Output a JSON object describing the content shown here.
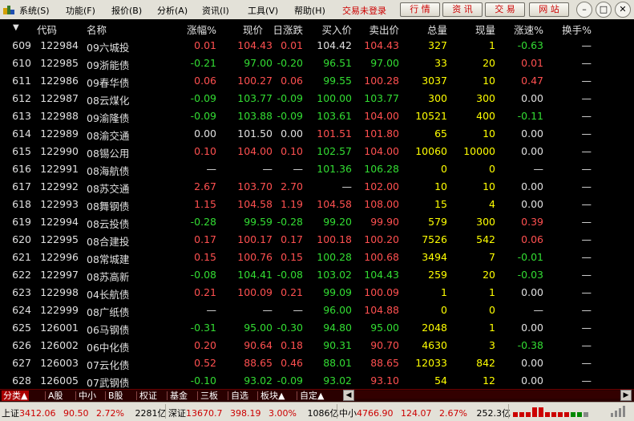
{
  "menubar": {
    "items": [
      "系统(S)",
      "功能(F)",
      "报价(B)",
      "分析(A)",
      "资讯(I)",
      "工具(V)",
      "帮助(H)"
    ],
    "trade_status": "交易未登录",
    "tool_buttons": [
      "行 情",
      "资 讯",
      "交 易",
      "网 站"
    ],
    "window_buttons": {
      "minimize": "–",
      "restore": "□",
      "close": "✕"
    }
  },
  "table": {
    "sort_indicator": "▼",
    "headers": {
      "code": "代码",
      "name": "名称",
      "change_pct": "涨幅%",
      "price": "现价",
      "day_change": "日涨跌",
      "bid": "买入价",
      "ask": "卖出价",
      "volume": "总量",
      "cur_vol": "现量",
      "speed": "涨速%",
      "turnover": "换手%"
    },
    "rows": [
      {
        "seq": "609",
        "code": "122984",
        "name": "09六城投",
        "chg": "0.01",
        "price": "104.43",
        "dchg": "0.01",
        "bid": "104.42",
        "ask": "104.43",
        "vol": "327",
        "cur": "1",
        "speed": "-0.63",
        "turn": "—",
        "c_chg": "up",
        "c_price": "up",
        "c_dchg": "up",
        "c_bid": "flat",
        "c_ask": "up",
        "c_speed": "down"
      },
      {
        "seq": "610",
        "code": "122985",
        "name": "09浙能债",
        "chg": "-0.21",
        "price": "97.00",
        "dchg": "-0.20",
        "bid": "96.51",
        "ask": "97.00",
        "vol": "33",
        "cur": "20",
        "speed": "0.01",
        "turn": "—",
        "c_chg": "down",
        "c_price": "down",
        "c_dchg": "down",
        "c_bid": "down",
        "c_ask": "down",
        "c_speed": "up"
      },
      {
        "seq": "611",
        "code": "122986",
        "name": "09春华债",
        "chg": "0.06",
        "price": "100.27",
        "dchg": "0.06",
        "bid": "99.55",
        "ask": "100.28",
        "vol": "3037",
        "cur": "10",
        "speed": "0.47",
        "turn": "—",
        "c_chg": "up",
        "c_price": "up",
        "c_dchg": "up",
        "c_bid": "down",
        "c_ask": "up",
        "c_speed": "up"
      },
      {
        "seq": "612",
        "code": "122987",
        "name": "08云煤化",
        "chg": "-0.09",
        "price": "103.77",
        "dchg": "-0.09",
        "bid": "100.00",
        "ask": "103.77",
        "vol": "300",
        "cur": "300",
        "speed": "0.00",
        "turn": "—",
        "c_chg": "down",
        "c_price": "down",
        "c_dchg": "down",
        "c_bid": "down",
        "c_ask": "down",
        "c_speed": "flat"
      },
      {
        "seq": "613",
        "code": "122988",
        "name": "09渝隆债",
        "chg": "-0.09",
        "price": "103.88",
        "dchg": "-0.09",
        "bid": "103.61",
        "ask": "104.00",
        "vol": "10521",
        "cur": "400",
        "speed": "-0.11",
        "turn": "—",
        "c_chg": "down",
        "c_price": "down",
        "c_dchg": "down",
        "c_bid": "down",
        "c_ask": "up",
        "c_speed": "down"
      },
      {
        "seq": "614",
        "code": "122989",
        "name": "08渝交通",
        "chg": "0.00",
        "price": "101.50",
        "dchg": "0.00",
        "bid": "101.51",
        "ask": "101.80",
        "vol": "65",
        "cur": "10",
        "speed": "0.00",
        "turn": "—",
        "c_chg": "flat",
        "c_price": "flat",
        "c_dchg": "flat",
        "c_bid": "up",
        "c_ask": "up",
        "c_speed": "flat"
      },
      {
        "seq": "615",
        "code": "122990",
        "name": "08锡公用",
        "chg": "0.10",
        "price": "104.00",
        "dchg": "0.10",
        "bid": "102.57",
        "ask": "104.00",
        "vol": "10060",
        "cur": "10000",
        "speed": "0.00",
        "turn": "—",
        "c_chg": "up",
        "c_price": "up",
        "c_dchg": "up",
        "c_bid": "down",
        "c_ask": "up",
        "c_speed": "flat"
      },
      {
        "seq": "616",
        "code": "122991",
        "name": "08海航债",
        "chg": "—",
        "price": "—",
        "dchg": "—",
        "bid": "101.36",
        "ask": "106.28",
        "vol": "0",
        "cur": "0",
        "speed": "—",
        "turn": "—",
        "c_chg": "flat",
        "c_price": "flat",
        "c_dchg": "flat",
        "c_bid": "down",
        "c_ask": "down",
        "c_speed": "flat"
      },
      {
        "seq": "617",
        "code": "122992",
        "name": "08苏交通",
        "chg": "2.67",
        "price": "103.70",
        "dchg": "2.70",
        "bid": "—",
        "ask": "102.00",
        "vol": "10",
        "cur": "10",
        "speed": "0.00",
        "turn": "—",
        "c_chg": "up",
        "c_price": "up",
        "c_dchg": "up",
        "c_bid": "flat",
        "c_ask": "up",
        "c_speed": "flat"
      },
      {
        "seq": "618",
        "code": "122993",
        "name": "08舞钢债",
        "chg": "1.15",
        "price": "104.58",
        "dchg": "1.19",
        "bid": "104.58",
        "ask": "108.00",
        "vol": "15",
        "cur": "4",
        "speed": "0.00",
        "turn": "—",
        "c_chg": "up",
        "c_price": "up",
        "c_dchg": "up",
        "c_bid": "up",
        "c_ask": "up",
        "c_speed": "flat"
      },
      {
        "seq": "619",
        "code": "122994",
        "name": "08云投债",
        "chg": "-0.28",
        "price": "99.59",
        "dchg": "-0.28",
        "bid": "99.20",
        "ask": "99.90",
        "vol": "579",
        "cur": "300",
        "speed": "0.39",
        "turn": "—",
        "c_chg": "down",
        "c_price": "down",
        "c_dchg": "down",
        "c_bid": "down",
        "c_ask": "up",
        "c_speed": "up"
      },
      {
        "seq": "620",
        "code": "122995",
        "name": "08合建投",
        "chg": "0.17",
        "price": "100.17",
        "dchg": "0.17",
        "bid": "100.18",
        "ask": "100.20",
        "vol": "7526",
        "cur": "542",
        "speed": "0.06",
        "turn": "—",
        "c_chg": "up",
        "c_price": "up",
        "c_dchg": "up",
        "c_bid": "up",
        "c_ask": "up",
        "c_speed": "up"
      },
      {
        "seq": "621",
        "code": "122996",
        "name": "08常城建",
        "chg": "0.15",
        "price": "100.76",
        "dchg": "0.15",
        "bid": "100.28",
        "ask": "100.68",
        "vol": "3494",
        "cur": "7",
        "speed": "-0.01",
        "turn": "—",
        "c_chg": "up",
        "c_price": "up",
        "c_dchg": "up",
        "c_bid": "down",
        "c_ask": "up",
        "c_speed": "down"
      },
      {
        "seq": "622",
        "code": "122997",
        "name": "08苏高新",
        "chg": "-0.08",
        "price": "104.41",
        "dchg": "-0.08",
        "bid": "103.02",
        "ask": "104.43",
        "vol": "259",
        "cur": "20",
        "speed": "-0.03",
        "turn": "—",
        "c_chg": "down",
        "c_price": "down",
        "c_dchg": "down",
        "c_bid": "down",
        "c_ask": "down",
        "c_speed": "down"
      },
      {
        "seq": "623",
        "code": "122998",
        "name": "04长航债",
        "chg": "0.21",
        "price": "100.09",
        "dchg": "0.21",
        "bid": "99.09",
        "ask": "100.09",
        "vol": "1",
        "cur": "1",
        "speed": "0.00",
        "turn": "—",
        "c_chg": "up",
        "c_price": "up",
        "c_dchg": "up",
        "c_bid": "down",
        "c_ask": "up",
        "c_speed": "flat"
      },
      {
        "seq": "624",
        "code": "122999",
        "name": "08广纸债",
        "chg": "—",
        "price": "—",
        "dchg": "—",
        "bid": "96.00",
        "ask": "104.88",
        "vol": "0",
        "cur": "0",
        "speed": "—",
        "turn": "—",
        "c_chg": "flat",
        "c_price": "flat",
        "c_dchg": "flat",
        "c_bid": "down",
        "c_ask": "up",
        "c_speed": "flat"
      },
      {
        "seq": "625",
        "code": "126001",
        "name": "06马钢债",
        "chg": "-0.31",
        "price": "95.00",
        "dchg": "-0.30",
        "bid": "94.80",
        "ask": "95.00",
        "vol": "2048",
        "cur": "1",
        "speed": "0.00",
        "turn": "—",
        "c_chg": "down",
        "c_price": "down",
        "c_dchg": "down",
        "c_bid": "down",
        "c_ask": "down",
        "c_speed": "flat"
      },
      {
        "seq": "626",
        "code": "126002",
        "name": "06中化债",
        "chg": "0.20",
        "price": "90.64",
        "dchg": "0.18",
        "bid": "90.31",
        "ask": "90.70",
        "vol": "4630",
        "cur": "3",
        "speed": "-0.38",
        "turn": "—",
        "c_chg": "up",
        "c_price": "up",
        "c_dchg": "up",
        "c_bid": "down",
        "c_ask": "up",
        "c_speed": "down"
      },
      {
        "seq": "627",
        "code": "126003",
        "name": "07云化债",
        "chg": "0.52",
        "price": "88.65",
        "dchg": "0.46",
        "bid": "88.01",
        "ask": "88.65",
        "vol": "12033",
        "cur": "842",
        "speed": "0.00",
        "turn": "—",
        "c_chg": "up",
        "c_price": "up",
        "c_dchg": "up",
        "c_bid": "down",
        "c_ask": "up",
        "c_speed": "flat"
      },
      {
        "seq": "628",
        "code": "126005",
        "name": "07武钢债",
        "chg": "-0.10",
        "price": "93.02",
        "dchg": "-0.09",
        "bid": "93.02",
        "ask": "93.10",
        "vol": "54",
        "cur": "12",
        "speed": "0.00",
        "turn": "—",
        "c_chg": "down",
        "c_price": "down",
        "c_dchg": "down",
        "c_bid": "down",
        "c_ask": "up",
        "c_speed": "flat"
      }
    ]
  },
  "tabs": [
    {
      "label": "分类▲",
      "active": true
    },
    {
      "label": "A股",
      "active": false
    },
    {
      "label": "中小",
      "active": false
    },
    {
      "label": "B股",
      "active": false
    },
    {
      "label": "权证",
      "active": false
    },
    {
      "label": "基金",
      "active": false
    },
    {
      "label": "三板",
      "active": false
    },
    {
      "label": "自选",
      "active": false
    },
    {
      "label": "板块▲",
      "active": false
    },
    {
      "label": "自定▲",
      "active": false
    }
  ],
  "statusbar": {
    "sh_label": "上证",
    "sh_index": "3412.06",
    "sh_change": "90.50",
    "sh_pct": "2.72%",
    "sh_amount": "2281亿",
    "sz_label": "深证",
    "sz_index": "13670.7",
    "sz_change": "398.19",
    "sz_pct": "3.00%",
    "sz_amount": "1086亿",
    "zx_label": "中小",
    "zx_index": "4766.90",
    "zx_change": "124.07",
    "zx_pct": "2.67%",
    "zx_amount": "252.3亿"
  },
  "colors": {
    "up": "#ff5050",
    "down": "#33dd33",
    "flat": "#e0e0e0",
    "volume": "#ffff00",
    "brand": "#cc0000"
  }
}
